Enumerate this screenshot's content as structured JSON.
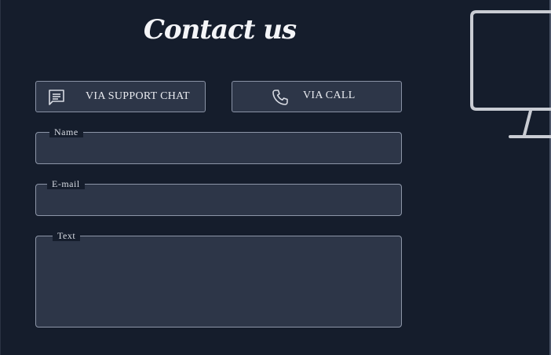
{
  "page": {
    "title": "Contact us"
  },
  "buttons": {
    "chat": {
      "label": "VIA SUPPORT CHAT",
      "icon": "chat-message-icon"
    },
    "call": {
      "label": "VIA CALL",
      "icon": "phone-icon"
    }
  },
  "form": {
    "name": {
      "label": "Name",
      "value": ""
    },
    "email": {
      "label": "E-mail",
      "value": ""
    },
    "text": {
      "label": "Text",
      "value": ""
    }
  },
  "decor": {
    "illustration": "monitor-icon"
  },
  "colors": {
    "background": "#151d2c",
    "field_background": "#2d3648",
    "border": "#8d96a8",
    "text": "#e6e8ee",
    "illustration": "#c9ccd3"
  }
}
